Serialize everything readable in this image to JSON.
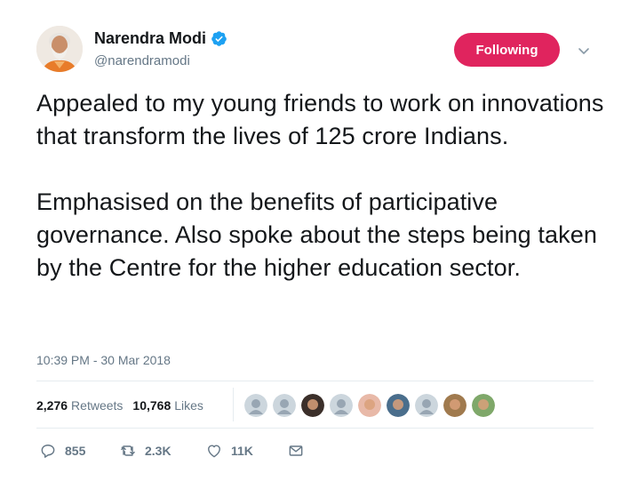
{
  "author": {
    "name": "Narendra Modi",
    "handle": "@narendramodi",
    "verified": true
  },
  "follow_button": {
    "label": "Following",
    "color": "#e0245e"
  },
  "menu": {
    "icon": "chevron-down-icon"
  },
  "tweet": {
    "text": "Appealed to my young friends to work on innovations that transform the lives of 125 crore Indians.\n\nEmphasised on the benefits of participative governance. Also spoke about the steps being taken by the Centre for the higher education sector.",
    "timestamp": "10:39 PM - 30 Mar 2018"
  },
  "stats": {
    "retweets_count": "2,276",
    "retweets_label": "Retweets",
    "likes_count": "10,768",
    "likes_label": "Likes"
  },
  "likers": [
    {
      "kind": "default-avatar",
      "color": "#98a6b3"
    },
    {
      "kind": "default-avatar",
      "color": "#98a6b3"
    },
    {
      "kind": "photo-avatar",
      "color": "#3b2f2a"
    },
    {
      "kind": "default-avatar",
      "color": "#98a6b3"
    },
    {
      "kind": "photo-avatar",
      "color": "#e8b9a8"
    },
    {
      "kind": "photo-avatar",
      "color": "#4a6e8c"
    },
    {
      "kind": "default-avatar",
      "color": "#98a6b3"
    },
    {
      "kind": "photo-avatar",
      "color": "#a07a4e"
    },
    {
      "kind": "photo-avatar",
      "color": "#7fa86a"
    }
  ],
  "actions": {
    "reply_count": "855",
    "retweet_count": "2.3K",
    "like_count": "11K",
    "reply_icon": "reply-icon",
    "retweet_icon": "retweet-icon",
    "like_icon": "heart-icon",
    "dm_icon": "envelope-icon"
  },
  "colors": {
    "text_primary": "#14171a",
    "text_secondary": "#657786",
    "verified_blue": "#1da1f2",
    "divider": "#e6ecf0"
  }
}
